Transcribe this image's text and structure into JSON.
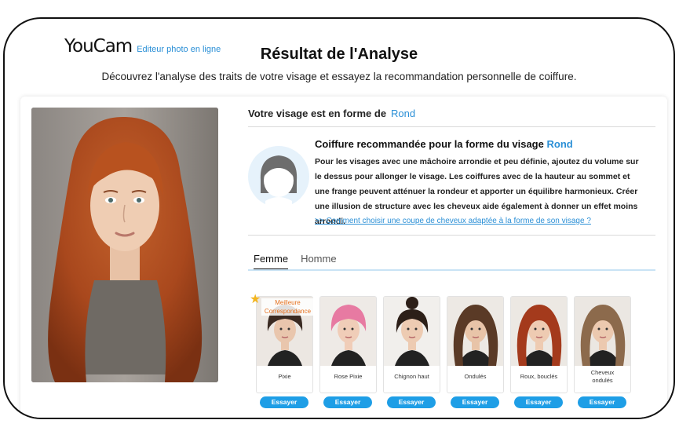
{
  "header": {
    "logo": "YouCam",
    "logo_sub": "Editeur photo en ligne",
    "title": "Résultat de l'Analyse",
    "subtitle": "Découvrez l'analyse des traits de votre visage et essayez la recommandation personnelle de coiffure."
  },
  "analysis": {
    "shape_label": "Votre visage est en forme de",
    "shape_value": "Rond",
    "rec_title_prefix": "Coiffure recommandée pour la forme du visage",
    "rec_title_shape": "Rond",
    "rec_text": "Pour les visages avec une mâchoire arrondie et peu définie, ajoutez du volume sur le dessus pour allonger le visage. Les coiffures avec de la hauteur au sommet et une frange peuvent atténuer la rondeur et apporter un équilibre harmonieux. Créer une illusion de structure avec les cheveux aide également à donner un effet moins arrondi.",
    "link": ">> Comment choisir une coupe de cheveux adaptée à la forme de son visage ?"
  },
  "tabs": [
    {
      "label": "Femme",
      "active": true
    },
    {
      "label": "Homme",
      "active": false
    }
  ],
  "best_badge": "Meilleure Correspondance",
  "try_label": "Essayer",
  "styles": [
    {
      "name": "Pixie",
      "hair_color": "#3a2a22",
      "skin": "#e9c6ad",
      "bg": "#ece7e2"
    },
    {
      "name": "Rose Pixie",
      "hair_color": "#e77aa2",
      "skin": "#f0cdb8",
      "bg": "#eeeae6"
    },
    {
      "name": "Chignon haut",
      "hair_color": "#2c1f18",
      "skin": "#edcbb2",
      "bg": "#f1efec"
    },
    {
      "name": "Ondulés",
      "hair_color": "#5a3a26",
      "skin": "#e8c4a8",
      "bg": "#ede9e4"
    },
    {
      "name": "Roux, bouclés",
      "hair_color": "#a43a1c",
      "skin": "#eecbb2",
      "bg": "#ece8e3"
    },
    {
      "name": "Cheveux ondulés",
      "hair_color": "#8c6a4c",
      "skin": "#ecc9af",
      "bg": "#ebe7e2"
    }
  ],
  "colors": {
    "accent": "#2a8fd6",
    "button": "#1e9ee6",
    "badge": "#e5701e"
  }
}
